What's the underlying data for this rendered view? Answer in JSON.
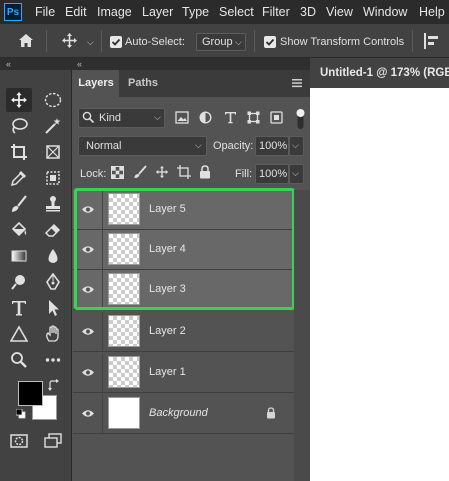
{
  "menubar": {
    "logo": "Ps",
    "items": [
      "File",
      "Edit",
      "Image",
      "Layer",
      "Type",
      "Select",
      "Filter",
      "3D",
      "View",
      "Window",
      "Help"
    ]
  },
  "options": {
    "auto_select_label": "Auto-Select:",
    "auto_select_value": "Group",
    "show_transform_label": "Show Transform Controls"
  },
  "collapse": {
    "left": "«",
    "right": "«"
  },
  "document": {
    "tab_title": "Untitled-1 @ 173% (RGB"
  },
  "layers_panel": {
    "tabs": [
      "Layers",
      "Paths"
    ],
    "filter_value": "Kind",
    "blend_mode": "Normal",
    "opacity_label": "Opacity:",
    "opacity_value": "100%",
    "lock_label": "Lock:",
    "fill_label": "Fill:",
    "fill_value": "100%",
    "layers": [
      {
        "name": "Layer 5",
        "selected": true
      },
      {
        "name": "Layer 4",
        "selected": true
      },
      {
        "name": "Layer 3",
        "selected": true
      },
      {
        "name": "Layer 2",
        "selected": false
      },
      {
        "name": "Layer 1",
        "selected": false
      },
      {
        "name": "Background",
        "selected": false,
        "locked": true
      }
    ]
  },
  "colors": {
    "selection_outline": "#39d353",
    "foreground": "#000000",
    "background": "#ffffff"
  }
}
